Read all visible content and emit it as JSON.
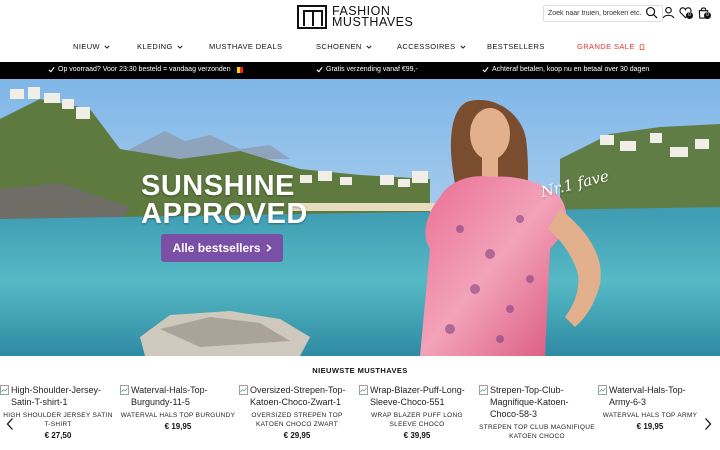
{
  "header": {
    "logo_line1": "FASHION",
    "logo_line2": "MUSTHAVES",
    "search_placeholder": "Zoek naar truien, broeken etc.",
    "wishlist_count": "0",
    "cart_count": "0"
  },
  "nav": {
    "items": [
      {
        "label": "NIEUW",
        "has_dropdown": true
      },
      {
        "label": "KLEDING",
        "has_dropdown": true
      },
      {
        "label": "MUSTHAVE DEALS",
        "has_dropdown": false
      },
      {
        "label": "SCHOENEN",
        "has_dropdown": true
      },
      {
        "label": "ACCESSOIRES",
        "has_dropdown": true
      },
      {
        "label": "BESTSELLERS",
        "has_dropdown": false
      },
      {
        "label": "GRANDE SALE",
        "has_dropdown": false
      }
    ],
    "sale_color": "#e0332f"
  },
  "usp": {
    "items": [
      {
        "text": "Op voorraad? Voor 23:30 besteld = vandaag verzonden"
      },
      {
        "text": "Gratis verzending vanaf €99,-"
      },
      {
        "text": "Achteraf betalen, koop nu en betaal over 30 dagen"
      }
    ]
  },
  "hero": {
    "headline_line1": "SUNSHINE",
    "headline_line2": "APPROVED",
    "cta_label": "Alle bestsellers",
    "cta_color": "#7a4fa6",
    "badge_text": "Nr.1 fave"
  },
  "products": {
    "section_title": "NIEUWSTE MUSTHAVES",
    "items": [
      {
        "alt": "High-Shoulder-Jersey-Satin-T-shirt-1",
        "name": "HIGH SHOULDER JERSEY SATIN T-SHIRT",
        "price": "€ 27,50"
      },
      {
        "alt": "Waterval-Hals-Top-Burgundy-11-5",
        "name": "WATERVAL HALS TOP BURGUNDY",
        "price": "€ 19,95"
      },
      {
        "alt": "Oversized-Strepen-Top-Katoen-Choco-Zwart-1",
        "name": "OVERSIZED STREPEN TOP KATOEN CHOCO ZWART",
        "price": "€ 29,95"
      },
      {
        "alt": "Wrap-Blazer-Puff-Long-Sleeve-Choco-551",
        "name": "WRAP BLAZER PUFF LONG SLEEVE CHOCO",
        "price": "€ 39,95"
      },
      {
        "alt": "Strepen-Top-Club-Magnifique-Katoen-Choco-58-3",
        "name": "STREPEN TOP CLUB MAGNIFIQUE KATOEN CHOCO",
        "price": ""
      },
      {
        "alt": "Waterval-Hals-Top-Army-6-3",
        "name": "WATERVAL HALS TOP ARMY",
        "price": "€ 19,95"
      }
    ]
  }
}
